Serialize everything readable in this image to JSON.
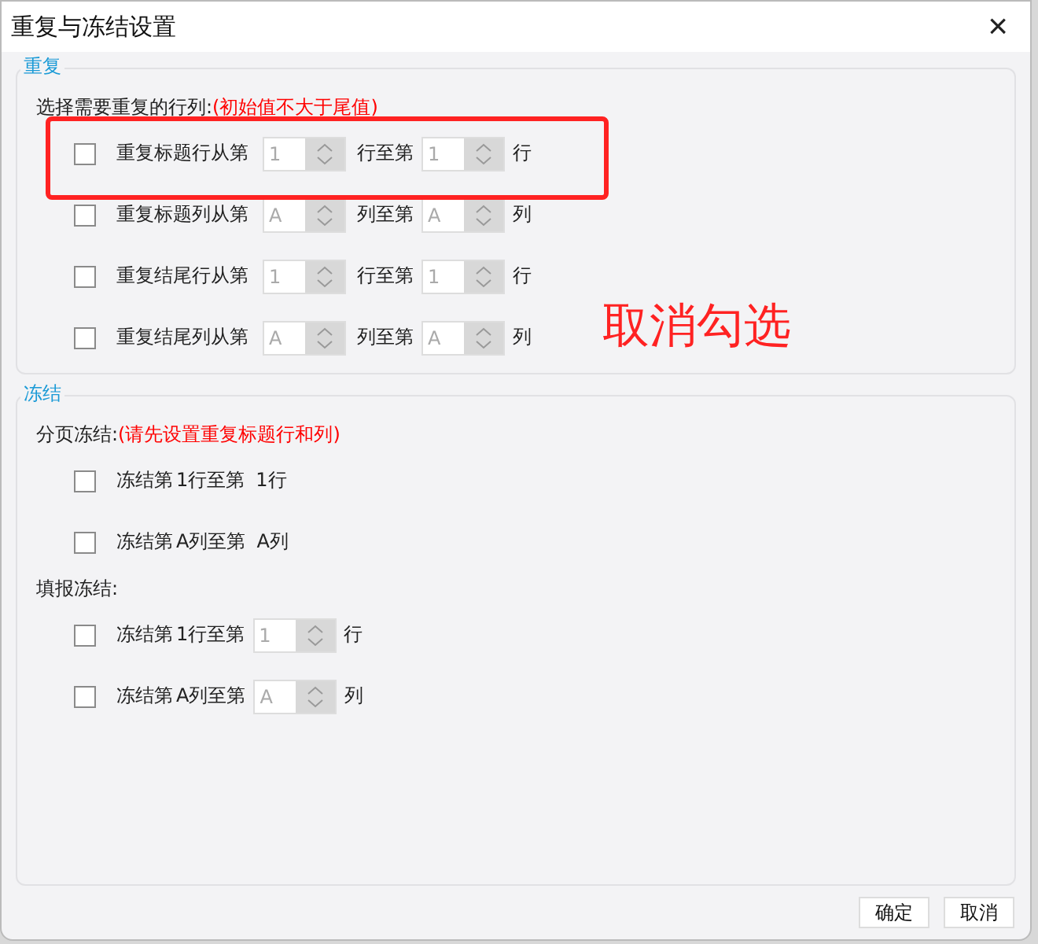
{
  "window": {
    "title": "重复与冻结设置",
    "close": "×"
  },
  "repeat": {
    "legend": "重复",
    "prompt": "选择需要重复的行列:",
    "hint": "(初始值不大于尾值)",
    "rows": [
      {
        "checked": false,
        "label": "重复标题行从第",
        "from": "1",
        "mid": "行至第",
        "to": "1",
        "unit": "行"
      },
      {
        "checked": false,
        "label": "重复标题列从第",
        "from": "A",
        "mid": "列至第",
        "to": "A",
        "unit": "列"
      },
      {
        "checked": false,
        "label": "重复结尾行从第",
        "from": "1",
        "mid": "行至第",
        "to": "1",
        "unit": "行"
      },
      {
        "checked": false,
        "label": "重复结尾列从第",
        "from": "A",
        "mid": "列至第",
        "to": "A",
        "unit": "列"
      }
    ]
  },
  "freeze": {
    "legend": "冻结",
    "groups": [
      {
        "title": "分页冻结:",
        "hint": "(请先设置重复标题行和列)",
        "rows": [
          {
            "kind": "plain",
            "checked": false,
            "label": "冻结第",
            "from": "1",
            "mid": "行至第",
            "to": "1",
            "unit": "行"
          },
          {
            "kind": "plain",
            "checked": false,
            "label": "冻结第",
            "from": "A",
            "mid": "列至第",
            "to": "A",
            "unit": "列"
          }
        ]
      },
      {
        "title": "填报冻结:",
        "rows": [
          {
            "kind": "spinner",
            "checked": false,
            "label": "冻结第",
            "from": "1",
            "mid": "行至第",
            "to": "1",
            "unit": "行"
          },
          {
            "kind": "spinner",
            "checked": false,
            "label": "冻结第",
            "from": "A",
            "mid": "列至第",
            "to": "A",
            "unit": "列"
          }
        ]
      }
    ]
  },
  "annotation": {
    "text": "取消勾选"
  },
  "buttons": [
    "确定",
    "取消"
  ]
}
